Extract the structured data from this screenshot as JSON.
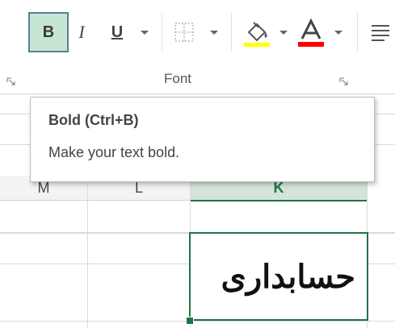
{
  "ribbon": {
    "bold_label": "B",
    "italic_label": "I",
    "underline_label": "U",
    "group_label": "Font",
    "icons": [
      "bold-icon",
      "italic-icon",
      "underline-icon",
      "borders-icon",
      "fill-color-icon",
      "font-color-icon",
      "align-icon",
      "dialog-launcher-icon"
    ],
    "fill_color": "#ffff00",
    "font_color": "#ff0000"
  },
  "tooltip": {
    "title": "Bold (Ctrl+B)",
    "description": "Make your text bold."
  },
  "columns": [
    {
      "label": "M",
      "selected": false
    },
    {
      "label": "L",
      "selected": false
    },
    {
      "label": "K",
      "selected": true
    }
  ],
  "cell": {
    "value": "حسابداری"
  },
  "colors": {
    "accent": "#217346",
    "bold_button_bg": "#c5e6d2"
  }
}
